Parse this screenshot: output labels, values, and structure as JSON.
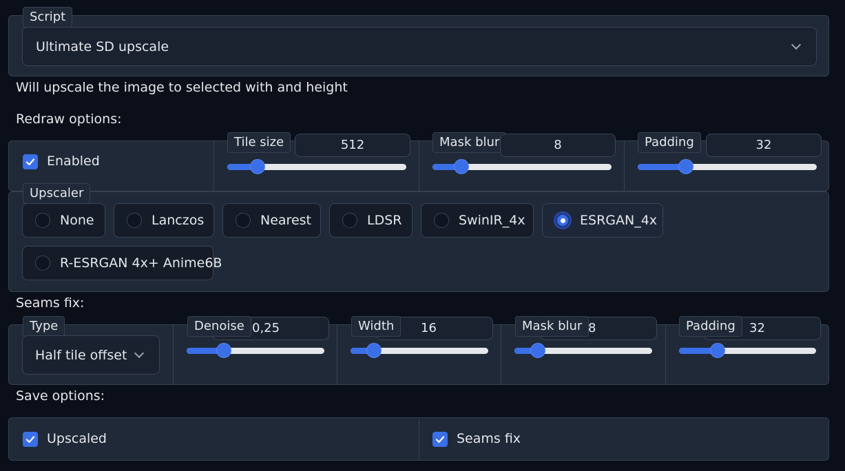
{
  "script": {
    "label": "Script",
    "selected": "Ultimate SD upscale"
  },
  "info_text": "Will upscale the image to selected with and height",
  "redraw": {
    "heading": "Redraw options:",
    "enabled_label": "Enabled",
    "enabled": true,
    "tile_size": {
      "label": "Tile size",
      "value": "512",
      "fraction": 0.17
    },
    "mask_blur": {
      "label": "Mask blur",
      "value": "8",
      "fraction": 0.16
    },
    "padding": {
      "label": "Padding",
      "value": "32",
      "fraction": 0.27
    }
  },
  "upscaler": {
    "label": "Upscaler",
    "options": [
      "None",
      "Lanczos",
      "Nearest",
      "LDSR",
      "SwinIR_4x",
      "ESRGAN_4x",
      "R-ESRGAN 4x+ Anime6B"
    ],
    "selected": "ESRGAN_4x"
  },
  "seams": {
    "heading": "Seams fix:",
    "type": {
      "label": "Type",
      "selected": "Half tile offset"
    },
    "denoise": {
      "label": "Denoise",
      "value": "0,25",
      "fraction": 0.27
    },
    "width": {
      "label": "Width",
      "value": "16",
      "fraction": 0.17
    },
    "mask_blur": {
      "label": "Mask blur",
      "value": "8",
      "fraction": 0.17
    },
    "padding": {
      "label": "Padding",
      "value": "32",
      "fraction": 0.28
    }
  },
  "save": {
    "heading": "Save options:",
    "upscaled_label": "Upscaled",
    "seams_fix_label": "Seams fix"
  },
  "colors": {
    "accent": "#3b6fe8",
    "panel": "#1f2937",
    "background": "#0b0f19"
  },
  "icons": [
    "chevron-down-icon",
    "check-icon"
  ]
}
